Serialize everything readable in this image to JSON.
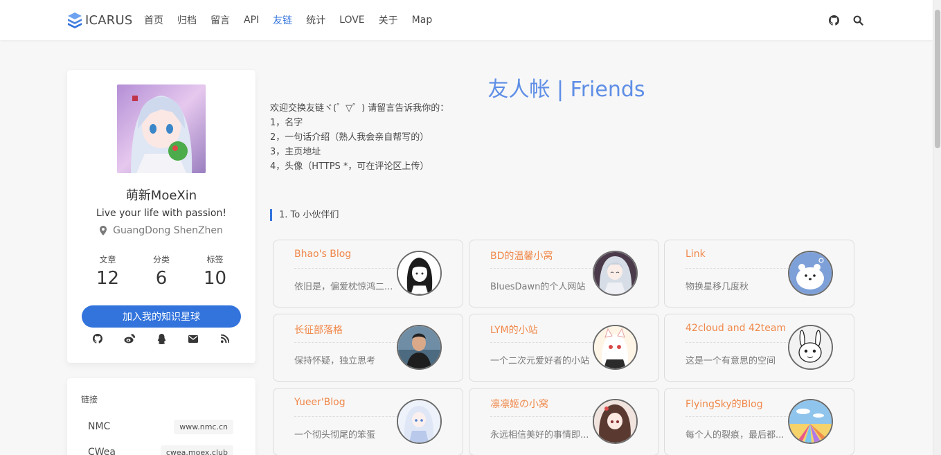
{
  "navbar": {
    "brand": "ICARUS",
    "items": [
      {
        "label": "首页"
      },
      {
        "label": "归档"
      },
      {
        "label": "留言"
      },
      {
        "label": "API"
      },
      {
        "label": "友链",
        "active": true
      },
      {
        "label": "统计"
      },
      {
        "label": "LOVE"
      },
      {
        "label": "关于"
      },
      {
        "label": "Map"
      }
    ],
    "icons": [
      "github-icon",
      "search-icon"
    ]
  },
  "profile": {
    "name": "萌新MoeXin",
    "motto": "Live your life with passion!",
    "location": "GuangDong ShenZhen",
    "stats": [
      {
        "label": "文章",
        "value": "12"
      },
      {
        "label": "分类",
        "value": "6"
      },
      {
        "label": "标签",
        "value": "10"
      }
    ],
    "join_button": "加入我的知识星球",
    "socials": [
      "github-icon",
      "weibo-icon",
      "qq-icon",
      "email-icon",
      "rss-icon"
    ]
  },
  "links_card": {
    "title": "链接",
    "items": [
      {
        "name": "NMC",
        "tag": "www.nmc.cn"
      },
      {
        "name": "CWea",
        "tag": "cwea.moex.club"
      }
    ]
  },
  "main": {
    "title": "友人帐 | Friends",
    "intro": [
      "欢迎交换友链ヾ(゜▽゜) 请留言告诉我你的：",
      "1，名字",
      "2，一句话介绍（熟人我会亲自帮写的）",
      "3，主页地址",
      "4，头像（HTTPS *，可在评论区上传）"
    ],
    "section": "1. To 小伙伴们",
    "friends": [
      {
        "name": "Bhao's Blog",
        "desc": "依旧是，偏爱枕惊鸿二..."
      },
      {
        "name": "BD的温馨小窝",
        "desc": "BluesDawn的个人网站"
      },
      {
        "name": "Link",
        "desc": "物换星移几度秋"
      },
      {
        "name": "长征部落格",
        "desc": "保持怀疑，独立思考"
      },
      {
        "name": "LYM的小站",
        "desc": "一个二次元爱好者的小站"
      },
      {
        "name": "42cloud and 42team",
        "desc": "这是一个有意思的空间"
      },
      {
        "name": "Yueer'Blog",
        "desc": "一个彻头彻尾的笨蛋"
      },
      {
        "name": "凛凛姬の小窝",
        "desc": "永远相信美好的事情即..."
      },
      {
        "name": "FlyingSky的Blog",
        "desc": "每个人的裂痕，最后都..."
      }
    ]
  },
  "colors": {
    "accent": "#3273dc",
    "title": "#5e8ee6",
    "friend_name": "#f0884a"
  }
}
